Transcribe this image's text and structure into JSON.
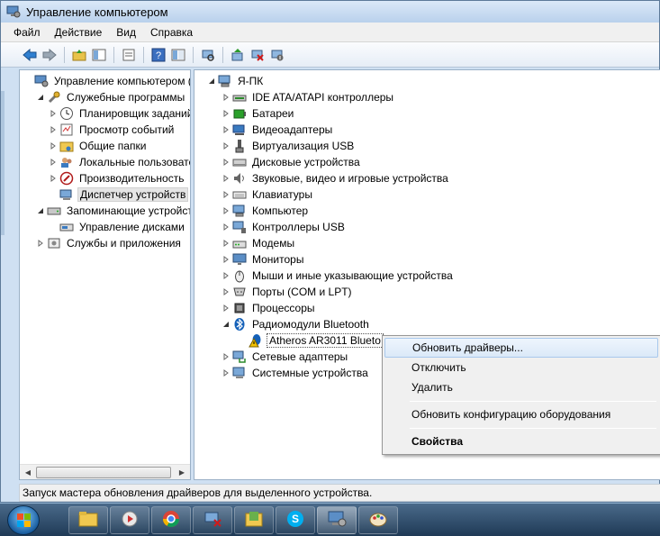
{
  "window": {
    "title": "Управление компьютером"
  },
  "menu": [
    "Файл",
    "Действие",
    "Вид",
    "Справка"
  ],
  "left_tree": [
    {
      "label": "Управление компьютером (л",
      "level": 0,
      "arrow": "",
      "icon": "computer-management-icon"
    },
    {
      "label": "Служебные программы",
      "level": 1,
      "arrow": "expanded",
      "icon": "tools-icon"
    },
    {
      "label": "Планировщик заданий",
      "level": 2,
      "arrow": "collapsed",
      "icon": "clock-icon"
    },
    {
      "label": "Просмотр событий",
      "level": 2,
      "arrow": "collapsed",
      "icon": "event-viewer-icon"
    },
    {
      "label": "Общие папки",
      "level": 2,
      "arrow": "collapsed",
      "icon": "shared-folder-icon"
    },
    {
      "label": "Локальные пользовате",
      "level": 2,
      "arrow": "collapsed",
      "icon": "users-icon"
    },
    {
      "label": "Производительность",
      "level": 2,
      "arrow": "collapsed",
      "icon": "performance-icon"
    },
    {
      "label": "Диспетчер устройств",
      "level": 2,
      "arrow": "",
      "icon": "device-manager-icon",
      "selected": true
    },
    {
      "label": "Запоминающие устройст",
      "level": 1,
      "arrow": "expanded",
      "icon": "storage-icon"
    },
    {
      "label": "Управление дисками",
      "level": 2,
      "arrow": "",
      "icon": "disk-management-icon"
    },
    {
      "label": "Службы и приложения",
      "level": 1,
      "arrow": "collapsed",
      "icon": "services-icon"
    }
  ],
  "device_tree": {
    "root": "Я-ПК",
    "categories": [
      {
        "label": "IDE ATA/ATAPI контроллеры",
        "icon": "ide-controller-icon"
      },
      {
        "label": "Батареи",
        "icon": "battery-icon"
      },
      {
        "label": "Видеоадаптеры",
        "icon": "display-adapter-icon"
      },
      {
        "label": "Виртуализация USB",
        "icon": "usb-virtualization-icon"
      },
      {
        "label": "Дисковые устройства",
        "icon": "disk-drive-icon"
      },
      {
        "label": "Звуковые, видео и игровые устройства",
        "icon": "sound-icon"
      },
      {
        "label": "Клавиатуры",
        "icon": "keyboard-icon"
      },
      {
        "label": "Компьютер",
        "icon": "computer-icon"
      },
      {
        "label": "Контроллеры USB",
        "icon": "usb-controller-icon"
      },
      {
        "label": "Модемы",
        "icon": "modem-icon"
      },
      {
        "label": "Мониторы",
        "icon": "monitor-icon"
      },
      {
        "label": "Мыши и иные указывающие устройства",
        "icon": "mouse-icon"
      },
      {
        "label": "Порты (COM и LPT)",
        "icon": "port-icon"
      },
      {
        "label": "Процессоры",
        "icon": "processor-icon"
      },
      {
        "label": "Радиомодули Bluetooth",
        "icon": "bluetooth-icon",
        "expanded": true
      },
      {
        "label": "Atheros AR3011 Blueto",
        "icon": "warning-device-icon",
        "child": true
      },
      {
        "label": "Сетевые адаптеры",
        "icon": "network-adapter-icon"
      },
      {
        "label": "Системные устройства",
        "icon": "system-device-icon"
      }
    ]
  },
  "context_menu": {
    "update": "Обновить драйверы...",
    "disable": "Отключить",
    "uninstall": "Удалить",
    "scan": "Обновить конфигурацию оборудования",
    "properties": "Свойства"
  },
  "status": "Запуск мастера обновления драйверов для выделенного устройства.",
  "colors": {
    "accent": "#3a6ea5",
    "warning": "#f2c200",
    "bluetooth": "#1460b8"
  }
}
